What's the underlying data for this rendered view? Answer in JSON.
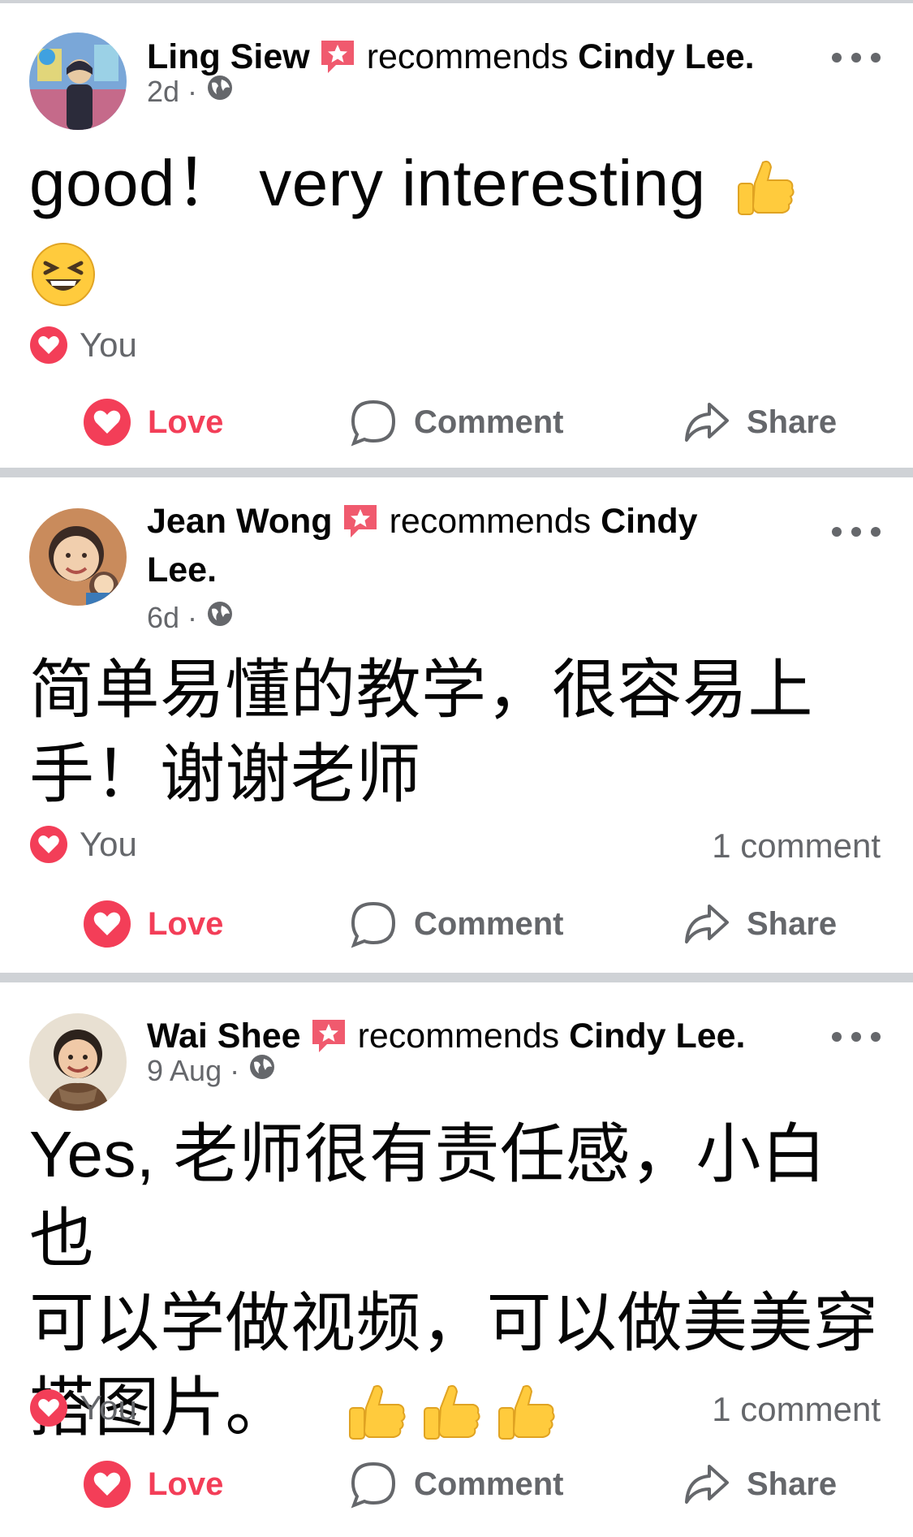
{
  "posts": [
    {
      "author": "Ling Siew",
      "recommends_text": "recommends",
      "target": "Cindy Lee.",
      "time": "2d",
      "text": "good！ very interesting",
      "emojis_line1": [
        "thumbs-up"
      ],
      "emojis_line2": [
        "grinning-squinting-face"
      ],
      "reaction_by": "You",
      "comment_count": "",
      "avatar_colors": [
        "#7aa7d8",
        "#e7c9a3",
        "#2b2b3a"
      ]
    },
    {
      "author": "Jean Wong",
      "recommends_text": "recommends",
      "target": "Cindy Lee.",
      "time": "6d",
      "text_line1": "简单易懂的教学，很容易上",
      "text_line2": "手！谢谢老师",
      "reaction_by": "You",
      "comment_count": "1 comment",
      "avatar_colors": [
        "#c98b5c",
        "#f1cfae",
        "#3a2a24"
      ]
    },
    {
      "author": "Wai Shee",
      "recommends_text": "recommends",
      "target": "Cindy Lee.",
      "time": "9 Aug",
      "text_line1": "Yes, 老师很有责任感，小白也",
      "text_line2": "可以学做视频，可以做美美穿",
      "text_line3": "搭图片。",
      "reaction_by": "You",
      "comment_count": "1 comment",
      "avatar_colors": [
        "#e8e0d2",
        "#f0c9a7",
        "#6b4a32"
      ]
    }
  ],
  "actions": {
    "love_label": "Love",
    "comment_label": "Comment",
    "share_label": "Share"
  },
  "colors": {
    "love_red": "#f33e58",
    "secondary_text": "#65676b",
    "divider": "#cfd2d6",
    "emoji_yellow": "#ffcb3d"
  },
  "icons": [
    "recommend-badge-icon",
    "globe-icon",
    "more-icon",
    "heart-icon",
    "comment-bubble-icon",
    "share-arrow-icon",
    "thumbs-up-emoji",
    "grinning-squinting-emoji"
  ]
}
